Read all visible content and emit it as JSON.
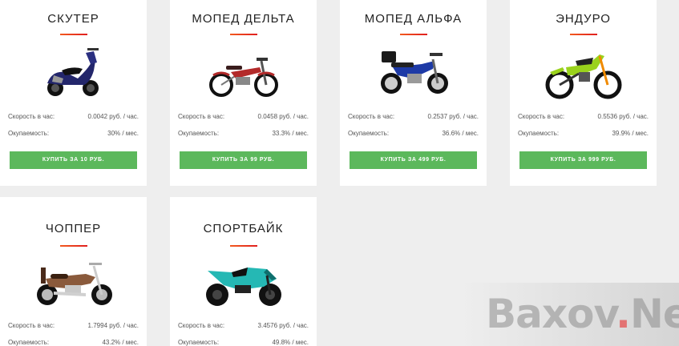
{
  "products": [
    {
      "title": "СКУТЕР",
      "speed_label": "Скорость в час:",
      "speed": "0.0042 руб. / час.",
      "payback_label": "Окупаемость:",
      "payback": "30% / мес.",
      "buy_label": "КУПИТЬ ЗА 10 РУБ.",
      "image": "scooter-image",
      "body_color": "#23266b"
    },
    {
      "title": "МОПЕД ДЕЛЬТА",
      "speed_label": "Скорость в час:",
      "speed": "0.0458 руб. / час.",
      "payback_label": "Окупаемость:",
      "payback": "33.3% / мес.",
      "buy_label": "КУПИТЬ ЗА 99 РУБ.",
      "image": "moped-delta-image",
      "body_color": "#b32a2a"
    },
    {
      "title": "МОПЕД АЛЬФА",
      "speed_label": "Скорость в час:",
      "speed": "0.2537 руб. / час.",
      "payback_label": "Окупаемость:",
      "payback": "36.6% / мес.",
      "buy_label": "КУПИТЬ ЗА 499 РУБ.",
      "image": "moped-alpha-image",
      "body_color": "#1e3aa6"
    },
    {
      "title": "ЭНДУРО",
      "speed_label": "Скорость в час:",
      "speed": "0.5536 руб. / час.",
      "payback_label": "Окупаемость:",
      "payback": "39.9% / мес.",
      "buy_label": "КУПИТЬ ЗА 999 РУБ.",
      "image": "enduro-image",
      "body_color": "#9ad21c"
    },
    {
      "title": "ЧОППЕР",
      "speed_label": "Скорость в час:",
      "speed": "1.7994 руб. / час.",
      "payback_label": "Окупаемость:",
      "payback": "43.2% / мес.",
      "buy_label": "",
      "image": "chopper-image",
      "body_color": "#8a5a3c"
    },
    {
      "title": "СПОРТБАЙК",
      "speed_label": "Скорость в час:",
      "speed": "3.4576 руб. / час.",
      "payback_label": "Окупаемость:",
      "payback": "49.8% / мес.",
      "buy_label": "",
      "image": "sportbike-image",
      "body_color": "#25b8b4"
    }
  ],
  "colors": {
    "accent_button": "#5cb85c",
    "title_underline": "#e63a1e",
    "card_bg": "#ffffff",
    "page_bg": "#eeeeee"
  },
  "watermark": {
    "text_a": "Baxov",
    "text_dot": ".",
    "text_b": "Net"
  }
}
